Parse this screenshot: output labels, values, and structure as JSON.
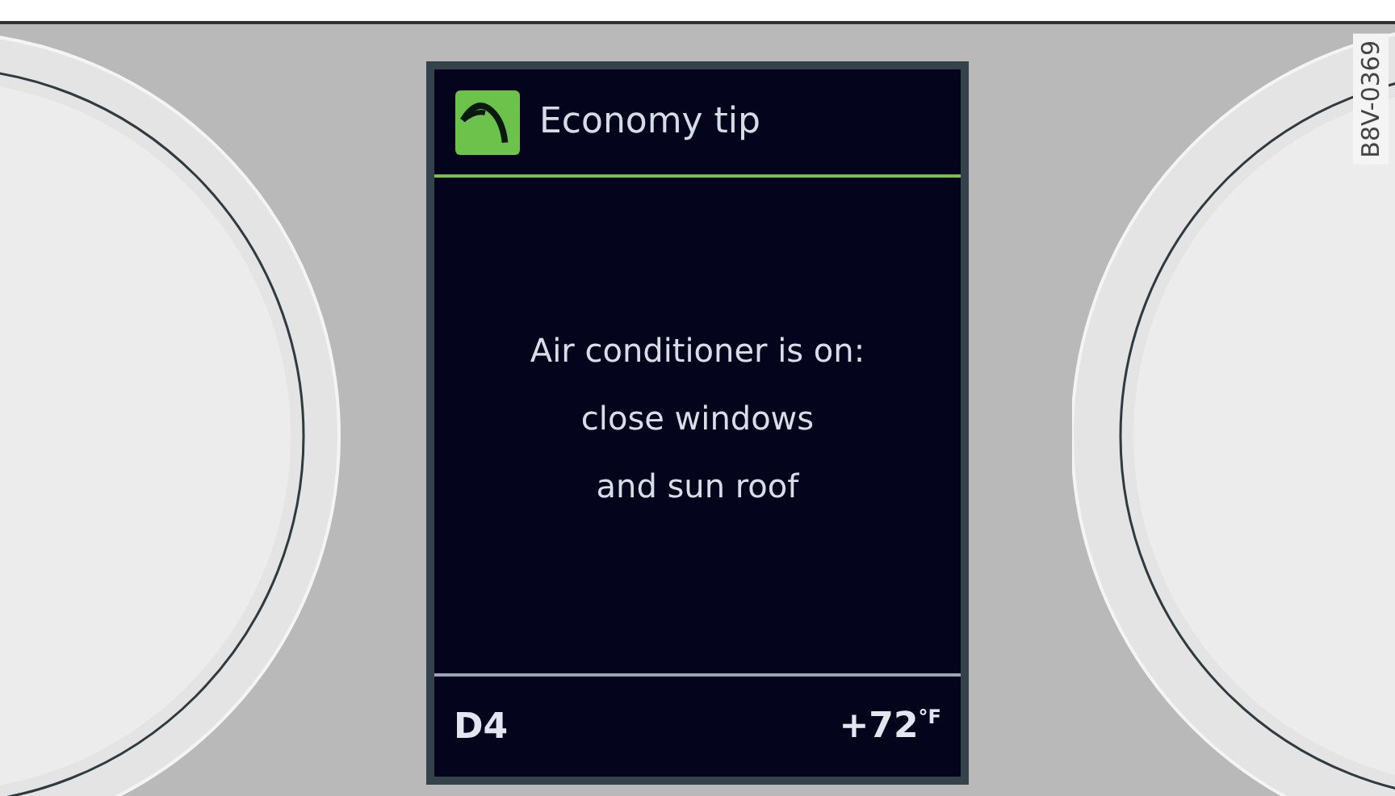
{
  "display": {
    "header": {
      "title": "Economy tip"
    },
    "message": "Air conditioner is on:\nclose windows\nand sun roof",
    "footer": {
      "gear": "D4",
      "temperature": "+72$^{°F}$"
    }
  },
  "figure_code": "B8V-0369"
}
